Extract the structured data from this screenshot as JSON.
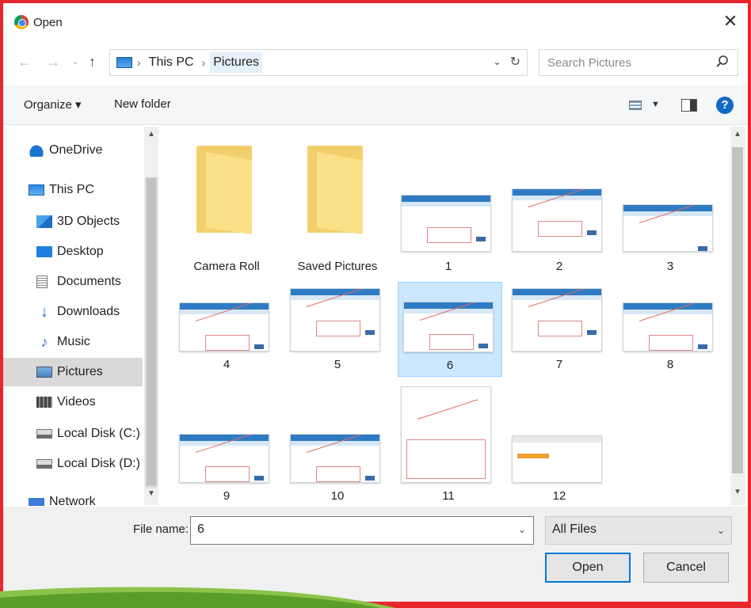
{
  "window": {
    "title": "Open",
    "close_glyph": "✕"
  },
  "nav_buttons": {
    "back": "←",
    "forward": "→",
    "recent": "⌄",
    "up": "↑"
  },
  "address": {
    "crumbs": [
      "This PC",
      "Pictures"
    ],
    "separator": "›",
    "dropdown_glyph": "⌄",
    "refresh_glyph": "↻"
  },
  "search": {
    "placeholder": "Search Pictures",
    "icon": "search-icon"
  },
  "toolbar": {
    "organize_label": "Organize ▾",
    "new_folder_label": "New folder",
    "view_dd": "▼",
    "help_label": "?"
  },
  "sidebar": {
    "items": [
      {
        "label": "OneDrive",
        "icon": "onedrive-icon"
      },
      {
        "label": "This PC",
        "icon": "computer-icon"
      },
      {
        "label": "3D Objects",
        "icon": "cube-icon"
      },
      {
        "label": "Desktop",
        "icon": "desktop-icon"
      },
      {
        "label": "Documents",
        "icon": "document-icon"
      },
      {
        "label": "Downloads",
        "icon": "download-icon"
      },
      {
        "label": "Music",
        "icon": "music-icon"
      },
      {
        "label": "Pictures",
        "icon": "pictures-icon",
        "selected": true
      },
      {
        "label": "Videos",
        "icon": "video-icon"
      },
      {
        "label": "Local Disk (C:)",
        "icon": "disk-icon"
      },
      {
        "label": "Local Disk (D:)",
        "icon": "disk-icon"
      },
      {
        "label": "Network",
        "icon": "network-icon"
      }
    ]
  },
  "files": {
    "folders": [
      "Camera Roll",
      "Saved Pictures"
    ],
    "images": [
      "1",
      "2",
      "3",
      "4",
      "5",
      "6",
      "7",
      "8",
      "9",
      "10",
      "11",
      "12"
    ],
    "selected": "6"
  },
  "scroll": {
    "up": "▲",
    "down": "▼"
  },
  "bottom": {
    "file_name_label": "File name:",
    "file_name_value": "6",
    "file_name_dd": "⌄",
    "type_value": "All Files",
    "type_dd": "⌄",
    "open_label": "Open",
    "cancel_label": "Cancel"
  },
  "colors": {
    "frame": "#e8262c",
    "selection": "#cce8ff",
    "accent": "#0078d7"
  }
}
